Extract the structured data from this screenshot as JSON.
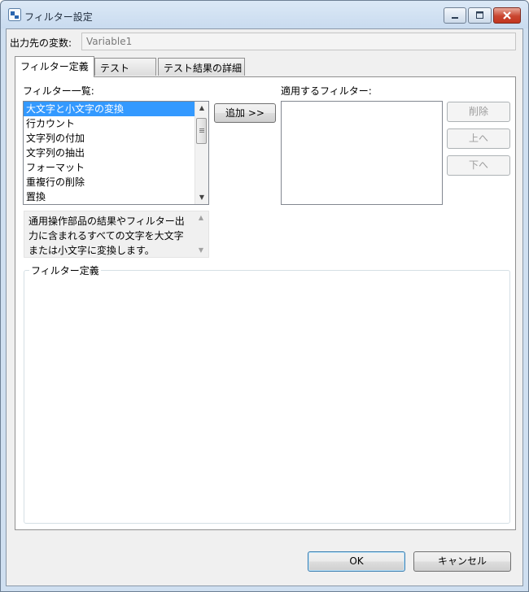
{
  "window": {
    "title": "フィルター設定",
    "app_icon": "app-icon",
    "controls": [
      "minimize-icon",
      "maximize-icon",
      "close-icon"
    ]
  },
  "output_variable": {
    "label": "出力先の変数:",
    "value": "Variable1"
  },
  "tabs": [
    {
      "label": "フィルター定義",
      "active": true
    },
    {
      "label": "テスト",
      "active": false
    },
    {
      "label": "テスト結果の詳細",
      "active": false
    }
  ],
  "filter_list": {
    "label": "フィルター一覧:",
    "items": [
      "大文字と小文字の変換",
      "行カウント",
      "文字列の付加",
      "文字列の抽出",
      "フォーマット",
      "重複行の削除",
      "置換"
    ],
    "selected_index": 0
  },
  "add_button": "追加 >>",
  "applied_filters": {
    "label": "適用するフィルター:",
    "items": []
  },
  "side_buttons": {
    "delete": "削除",
    "up": "上へ",
    "down": "下へ"
  },
  "description": {
    "lines": [
      "通用操作部品の結果やフィルター出",
      "力に含まれるすべての文字を大文字",
      "または小文字に変換します。"
    ]
  },
  "definition_group": {
    "label": "フィルター定義"
  },
  "footer": {
    "ok": "OK",
    "cancel": "キャンセル"
  },
  "colors": {
    "selection": "#3399ff",
    "title_bar": "#c9dbef",
    "close_button": "#c9452f"
  }
}
